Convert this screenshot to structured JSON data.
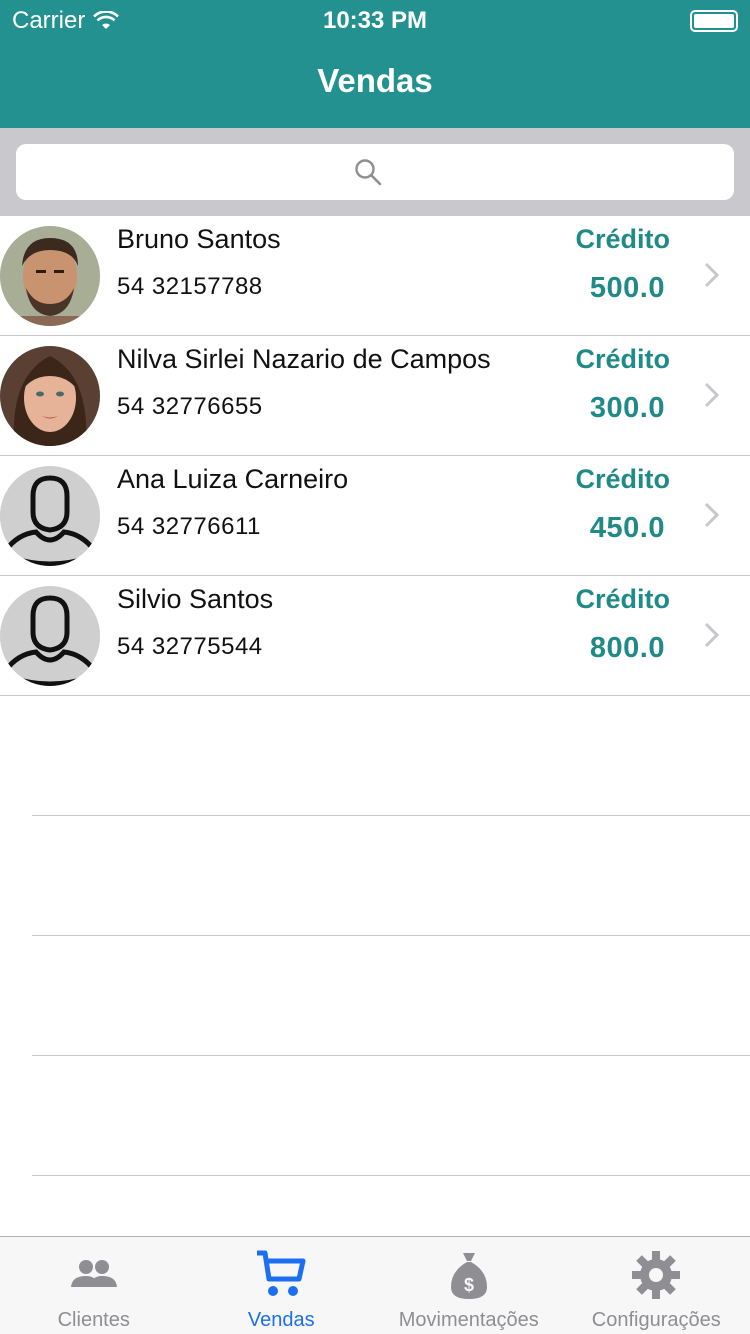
{
  "status_bar": {
    "carrier": "Carrier",
    "time": "10:33 PM"
  },
  "nav": {
    "title": "Vendas"
  },
  "search": {
    "placeholder": ""
  },
  "clients": [
    {
      "name": "Bruno Santos",
      "phone": "54 32157788",
      "credit_label": "Crédito",
      "credit_value": "500.0",
      "avatar": "photo-man"
    },
    {
      "name": "Nilva Sirlei Nazario de Campos",
      "phone": "54 32776655",
      "credit_label": "Crédito",
      "credit_value": "300.0",
      "avatar": "photo-woman"
    },
    {
      "name": "Ana Luiza Carneiro",
      "phone": "54 32776611",
      "credit_label": "Crédito",
      "credit_value": "450.0",
      "avatar": "placeholder-person"
    },
    {
      "name": "Silvio Santos",
      "phone": "54 32775544",
      "credit_label": "Crédito",
      "credit_value": "800.0",
      "avatar": "placeholder-person"
    }
  ],
  "tabs": [
    {
      "label": "Clientes",
      "icon": "people-icon",
      "active": false
    },
    {
      "label": "Vendas",
      "icon": "cart-icon",
      "active": true
    },
    {
      "label": "Movimentações",
      "icon": "money-bag-icon",
      "active": false
    },
    {
      "label": "Configurações",
      "icon": "gear-icon",
      "active": false
    }
  ],
  "colors": {
    "header": "#22918f",
    "accent": "#1f8a87",
    "tab_active": "#1c6ef2",
    "tab_inactive": "#8e8e93"
  }
}
